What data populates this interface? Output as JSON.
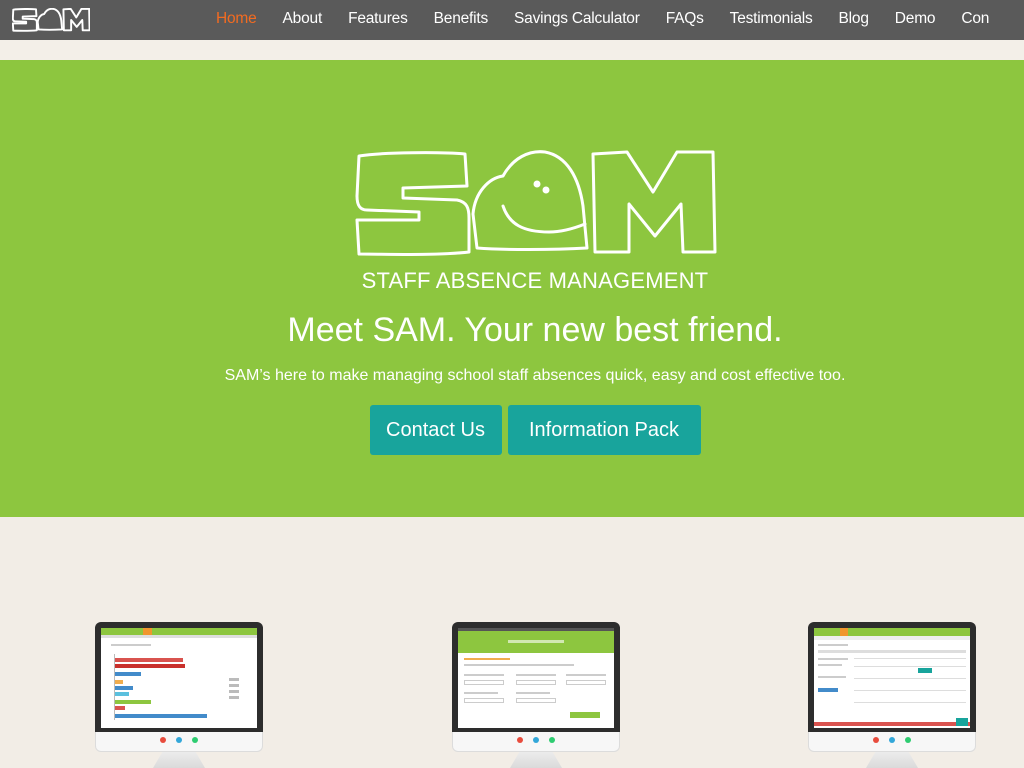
{
  "brand": {
    "logo_text": "SAM",
    "tagline": "STAFF ABSENCE MANAGEMENT"
  },
  "nav": {
    "items": [
      {
        "label": "Home",
        "active": true
      },
      {
        "label": "About",
        "active": false
      },
      {
        "label": "Features",
        "active": false
      },
      {
        "label": "Benefits",
        "active": false
      },
      {
        "label": "Savings Calculator",
        "active": false
      },
      {
        "label": "FAQs",
        "active": false
      },
      {
        "label": "Testimonials",
        "active": false
      },
      {
        "label": "Blog",
        "active": false
      },
      {
        "label": "Demo",
        "active": false
      },
      {
        "label": "Con",
        "active": false
      }
    ]
  },
  "hero": {
    "title": "Meet SAM. Your new best friend.",
    "subtitle": "SAM’s here to make managing school staff absences quick, easy and cost effective too.",
    "buttons": {
      "contact": "Contact Us",
      "info": "Information Pack"
    }
  },
  "colors": {
    "nav_bg": "#5a5a5a",
    "active": "#f26b21",
    "green": "#8dc63f",
    "teal": "#18a49c",
    "page_bg": "#f2ede6",
    "monitor_dots": [
      "#e84c3d",
      "#33a7d9",
      "#2ecc71"
    ]
  }
}
